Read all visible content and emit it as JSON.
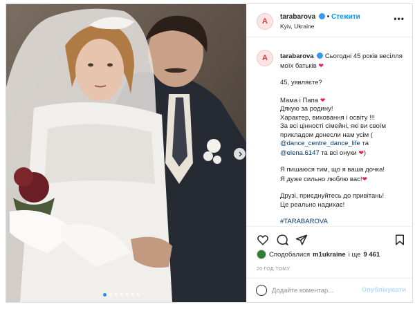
{
  "post": {
    "username": "tarabarova",
    "follow_label": "Стежити",
    "location": "Kyiv, Ukraine",
    "more_label": "•••",
    "avatar_letter": "A"
  },
  "caption": {
    "username": "tarabarova",
    "line1": "Сьогодні 45 років весілля моїх батьків",
    "p2": "45, уявляєте?",
    "p3_a": "Мама і Папа",
    "p3_b": "Дякую за родину!",
    "p3_c": "Характер, виховання і освіту !!!",
    "p3_d": "За всі цінності сімейні, які ви своїм прикладом донесли нам усім (",
    "link1": "@dance_centre_dance_life",
    "p3_and": "та",
    "link2": "@elena.6147",
    "p3_e": "та всі онуки",
    "p3_close": ")",
    "p4_a": "Я пишаюся тим, що я ваша дочка!",
    "p4_b": "Я дуже сильно люблю вас!",
    "p5_a": "Друзі, приєднуйтесь до привітань!",
    "p5_b": "Це реально надихає!",
    "hashtag": "#TARABAROVA"
  },
  "icons": {
    "like": "heart-outline-icon",
    "comment": "comment-icon",
    "share": "share-icon",
    "save": "bookmark-icon",
    "next": "chevron-right-icon",
    "emoji": "emoji-icon"
  },
  "likes": {
    "prefix": "Сподобалися",
    "user": "m1ukraine",
    "middle": "і ще",
    "count": "9 461"
  },
  "time_ago": "20 ГОД ТОМУ",
  "comment_box": {
    "placeholder": "Додайте коментар...",
    "publish_label": "Опублікувати"
  },
  "carousel": {
    "count": 7,
    "active": 0
  },
  "colors": {
    "link": "#00376b",
    "accent": "#0095f6",
    "heart": "#e0245e"
  }
}
